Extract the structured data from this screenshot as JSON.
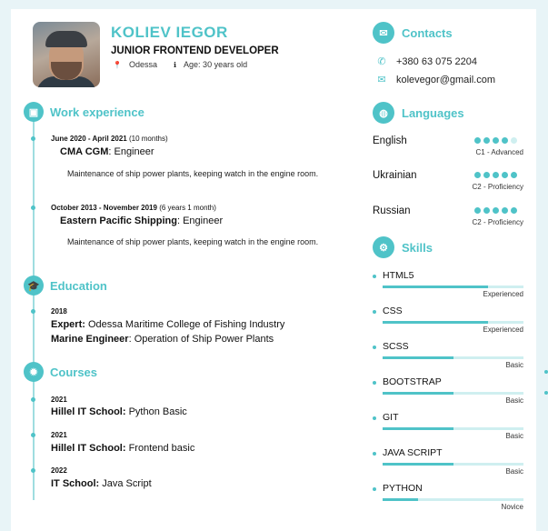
{
  "header": {
    "name": "KOLIEV IEGOR",
    "title": "JUNIOR FRONTEND DEVELOPER",
    "location_icon": "map-pin-icon",
    "location": "Odessa",
    "age_icon": "info-icon",
    "age": "Age: 30 years old"
  },
  "sections": {
    "work": "Work experience",
    "education": "Education",
    "courses": "Courses",
    "contacts": "Contacts",
    "languages": "Languages",
    "skills": "Skills"
  },
  "work": [
    {
      "date": "June 2020 - April 2021",
      "duration": "(10 months)",
      "company": "CMA CGM",
      "role": ": Engineer",
      "description": "Maintenance of ship power plants, keeping watch in the engine room."
    },
    {
      "date": "October 2013 - November 2019",
      "duration": "(6 years 1 month)",
      "company": "Eastern Pacific Shipping",
      "role": ": Engineer",
      "description": "Maintenance of ship power plants, keeping watch in the engine room."
    }
  ],
  "education": {
    "year": "2018",
    "line1_bold": "Expert:",
    "line1_rest": " Odessa Maritime College of Fishing Industry",
    "line2_bold": "Marine Engineer",
    "line2_rest": ": Operation of Ship Power Plants"
  },
  "courses": [
    {
      "year": "2021",
      "school": "Hillel IT School:",
      "course": " Python Basic"
    },
    {
      "year": "2021",
      "school": "Hillel IT School:",
      "course": " Frontend basic"
    },
    {
      "year": "2022",
      "school": "IT School:",
      "course": " Java Script"
    }
  ],
  "contacts": {
    "phone_icon": "phone-icon",
    "phone": "+380 63 075 2204",
    "email_icon": "mail-icon",
    "email": "kolevegor@gmail.com"
  },
  "languages": [
    {
      "name": "English",
      "level": "C1 - Advanced",
      "dots": 4
    },
    {
      "name": "Ukrainian",
      "level": "C2 - Proficiency",
      "dots": 5
    },
    {
      "name": "Russian",
      "level": "C2 - Proficiency",
      "dots": 5
    }
  ],
  "skills": [
    {
      "name": "HTML5",
      "level": "Experienced",
      "fill": 0.75
    },
    {
      "name": "CSS",
      "level": "Experienced",
      "fill": 0.75
    },
    {
      "name": "SCSS",
      "level": "Basic",
      "fill": 0.5
    },
    {
      "name": "BOOTSTRAP",
      "level": "Basic",
      "fill": 0.5
    },
    {
      "name": "GIT",
      "level": "Basic",
      "fill": 0.5
    },
    {
      "name": "JAVA SCRIPT",
      "level": "Basic",
      "fill": 0.5
    },
    {
      "name": "PYTHON",
      "level": "Novice",
      "fill": 0.25
    }
  ],
  "colors": {
    "accent": "#4fc3c8",
    "accent_light": "#cfeff0"
  }
}
